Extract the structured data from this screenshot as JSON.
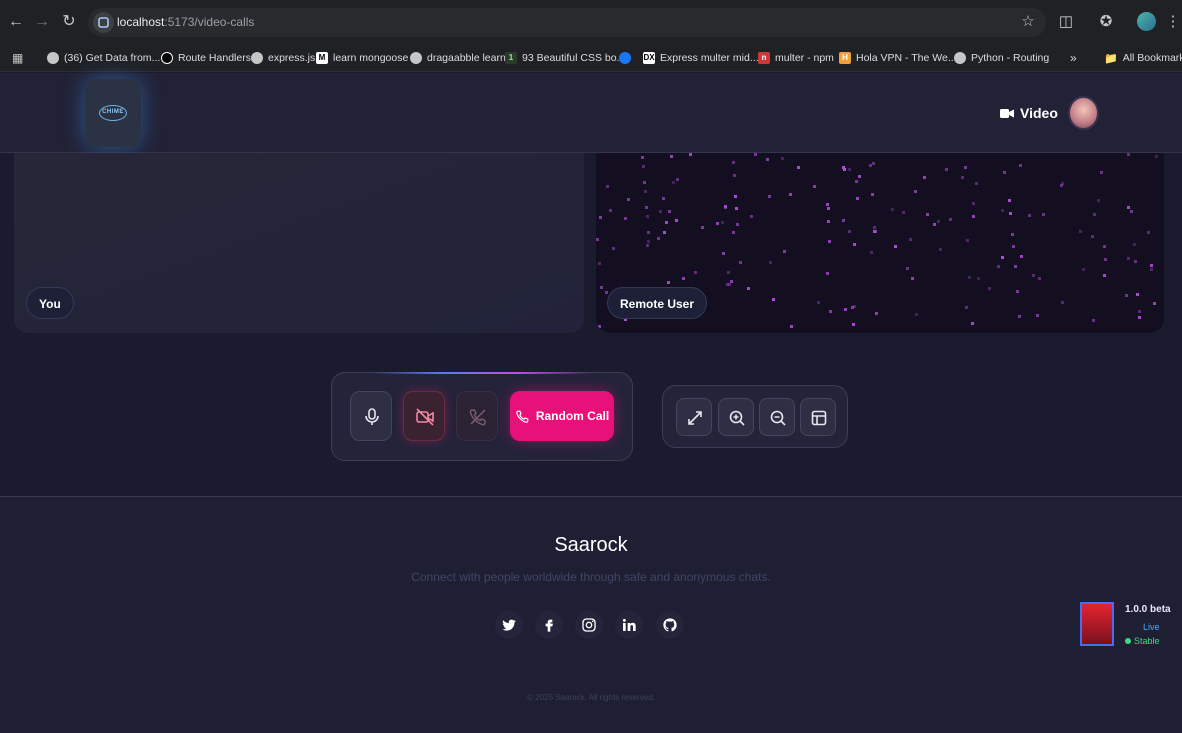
{
  "browser": {
    "url_host": "localhost",
    "url_path": ":5173/video-calls",
    "bookmarks": [
      {
        "label": "(36) Get Data from...",
        "icon": "globe-icon"
      },
      {
        "label": "Route Handlers",
        "icon": "nextjs-icon"
      },
      {
        "label": "express.js",
        "icon": "globe-icon"
      },
      {
        "label": "learn mongoose",
        "icon": "medium-icon"
      },
      {
        "label": "dragaabble learn",
        "icon": "globe-icon"
      },
      {
        "label": "93 Beautiful CSS bo...",
        "icon": "site-icon"
      },
      {
        "label": "",
        "icon": "facebook-icon"
      },
      {
        "label": "Express multer mid...",
        "icon": "site-icon"
      },
      {
        "label": "multer - npm",
        "icon": "npm-icon"
      },
      {
        "label": "Hola VPN - The We...",
        "icon": "site-icon"
      },
      {
        "label": "Python - Routing",
        "icon": "globe-icon"
      }
    ],
    "all_bookmarks": "All Bookmarks",
    "more": "»"
  },
  "header": {
    "logo_text": "CHIME",
    "video_label": "Video"
  },
  "tiles": {
    "local_label": "You",
    "remote_label": "Remote User"
  },
  "controls": {
    "random_call_label": "Random Call"
  },
  "footer": {
    "brand": "Saarock",
    "tagline": "Connect with people worldwide through safe and anonymous chats.",
    "copyright": "© 2025 Saarock. All rights reserved."
  },
  "version": {
    "version_label": "1.0.0 beta",
    "live_label": "Live",
    "stable_label": "Stable"
  },
  "colors": {
    "accent": "#e8117a",
    "background": "#1b1b2f",
    "panel": "#23233a"
  }
}
